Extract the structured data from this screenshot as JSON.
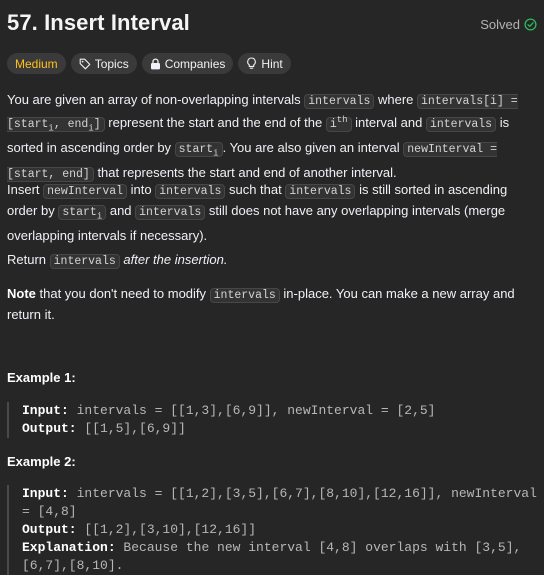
{
  "problem": {
    "title": "57. Insert Interval",
    "solved_label": "Solved"
  },
  "tags": {
    "difficulty": "Medium",
    "topics": "Topics",
    "companies": "Companies",
    "hint": "Hint"
  },
  "description": {
    "p1": {
      "t1": "You are given an array of non-overlapping intervals ",
      "c1": "intervals",
      "t2": " where ",
      "c2": "intervals[i] = [start",
      "c2_sub1": "i",
      "c2_mid": ", end",
      "c2_sub2": "i",
      "c2_end": "]",
      "t3": " represent the start and the end of the ",
      "c3": "i",
      "c3_sup": "th",
      "t4": " interval and ",
      "c4": "intervals",
      "t5": " is sorted in ascending order by ",
      "c5": "start",
      "c5_sub": "i",
      "t6": ". You are also given an interval ",
      "c6": "newInterval = [start, end]",
      "t7": " that represents the start and end of another interval."
    },
    "p2": {
      "t1": "Insert ",
      "c1": "newInterval",
      "t2": " into ",
      "c2": "intervals",
      "t3": " such that ",
      "c3": "intervals",
      "t4": " is still sorted in ascending order by ",
      "c4": "start",
      "c4_sub": "i",
      "t5": " and ",
      "c5": "intervals",
      "t6": " still does not have any overlapping intervals (merge overlapping intervals if necessary)."
    },
    "p3": {
      "t1": "Return ",
      "c1": "intervals",
      "t2": "after the insertion."
    },
    "p4": {
      "b1": "Note",
      "t1": " that you don't need to modify ",
      "c1": "intervals",
      "t2": " in-place. You can make a new array and return it."
    }
  },
  "examples": [
    {
      "title": "Example 1:",
      "input_label": "Input:",
      "input": " intervals = [[1,3],[6,9]], newInterval = [2,5]",
      "output_label": "Output:",
      "output": " [[1,5],[6,9]]"
    },
    {
      "title": "Example 2:",
      "input_label": "Input:",
      "input": " intervals = [[1,2],[3,5],[6,7],[8,10],[12,16]], newInterval = [4,8]",
      "output_label": "Output:",
      "output": " [[1,2],[3,10],[12,16]]",
      "explanation_label": "Explanation:",
      "explanation": " Because the new interval [4,8] overlaps with [3,5],[6,7],[8,10]."
    }
  ],
  "colors": {
    "background": "#262626",
    "medium": "#ffc01e",
    "solved_check": "#2cbb5d"
  }
}
